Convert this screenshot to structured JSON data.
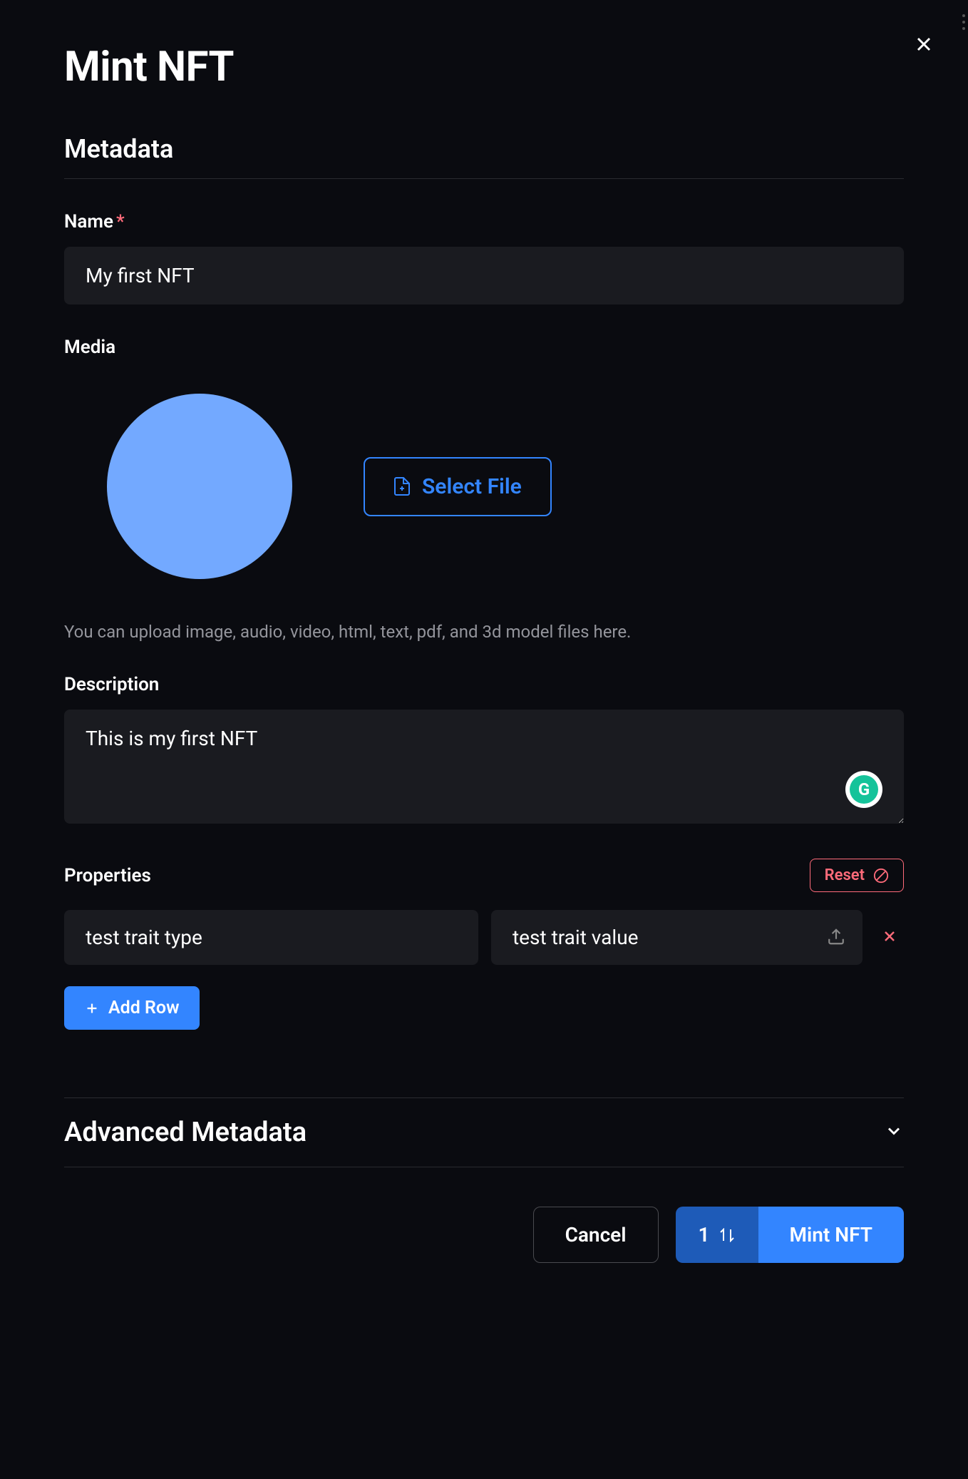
{
  "modal": {
    "title": "Mint NFT"
  },
  "metadata": {
    "section_label": "Metadata",
    "name": {
      "label": "Name",
      "value": "My first NFT"
    },
    "media": {
      "label": "Media",
      "select_file_label": "Select File",
      "help_text": "You can upload image, audio, video, html, text, pdf, and 3d model files here."
    },
    "description": {
      "label": "Description",
      "value": "This is my first NFT"
    },
    "properties": {
      "label": "Properties",
      "reset_label": "Reset",
      "rows": [
        {
          "trait_type": "test trait type",
          "trait_value": "test trait value"
        }
      ],
      "add_row_label": "Add Row"
    }
  },
  "advanced": {
    "label": "Advanced Metadata"
  },
  "actions": {
    "cancel_label": "Cancel",
    "count": "1",
    "mint_label": "Mint NFT"
  }
}
